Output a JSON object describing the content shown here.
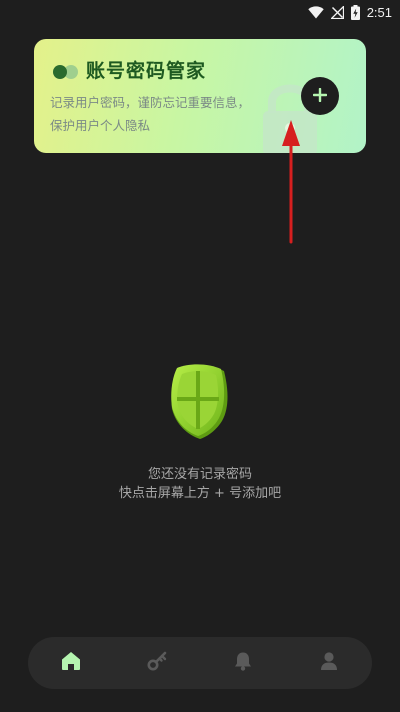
{
  "status_bar": {
    "time": "2:51",
    "icons": [
      "wifi-icon",
      "signal-off-icon",
      "battery-charging-icon"
    ]
  },
  "header_card": {
    "title": "账号密码管家",
    "description": "记录用户密码，谨防忘记重要信息，保护用户个人隐私",
    "add_button_icon": "plus-icon",
    "decor_icons": [
      "toggle-icon",
      "lock-icon"
    ]
  },
  "empty_state": {
    "icon": "shield-icon",
    "line1": "您还没有记录密码",
    "line2": "快点击屏幕上方 + 号添加吧"
  },
  "bottom_nav": {
    "items": [
      {
        "icon": "home-icon",
        "active": true
      },
      {
        "icon": "key-icon",
        "active": false
      },
      {
        "icon": "bell-icon",
        "active": false
      },
      {
        "icon": "user-icon",
        "active": false
      }
    ]
  },
  "colors": {
    "background": "#1e1e1e",
    "card_gradient_start": "#e4f18a",
    "card_gradient_end": "#b2f3c8",
    "title_green": "#1e5a21",
    "accent": "#b5f5b0",
    "annotation_arrow": "#d61f1f"
  }
}
